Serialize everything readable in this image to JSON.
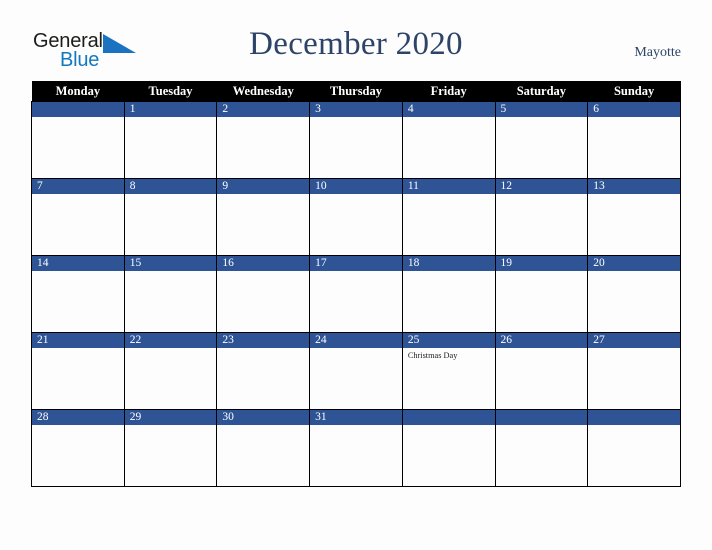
{
  "brand": {
    "name_part1": "General",
    "name_part2": "Blue",
    "flag_icon": "blue-triangle-flag-icon"
  },
  "header": {
    "title": "December 2020",
    "region": "Mayotte"
  },
  "colors": {
    "accent_blue": "#2f5496",
    "header_black": "#000000",
    "title_navy": "#2d4468",
    "logo_blue": "#1279be",
    "page_background": "#fdfdfd"
  },
  "calendar": {
    "month": "December",
    "year": "2020",
    "weekday_headers": [
      "Monday",
      "Tuesday",
      "Wednesday",
      "Thursday",
      "Friday",
      "Saturday",
      "Sunday"
    ],
    "weeks": [
      [
        {
          "day": "",
          "events": []
        },
        {
          "day": "1",
          "events": []
        },
        {
          "day": "2",
          "events": []
        },
        {
          "day": "3",
          "events": []
        },
        {
          "day": "4",
          "events": []
        },
        {
          "day": "5",
          "events": []
        },
        {
          "day": "6",
          "events": []
        }
      ],
      [
        {
          "day": "7",
          "events": []
        },
        {
          "day": "8",
          "events": []
        },
        {
          "day": "9",
          "events": []
        },
        {
          "day": "10",
          "events": []
        },
        {
          "day": "11",
          "events": []
        },
        {
          "day": "12",
          "events": []
        },
        {
          "day": "13",
          "events": []
        }
      ],
      [
        {
          "day": "14",
          "events": []
        },
        {
          "day": "15",
          "events": []
        },
        {
          "day": "16",
          "events": []
        },
        {
          "day": "17",
          "events": []
        },
        {
          "day": "18",
          "events": []
        },
        {
          "day": "19",
          "events": []
        },
        {
          "day": "20",
          "events": []
        }
      ],
      [
        {
          "day": "21",
          "events": []
        },
        {
          "day": "22",
          "events": []
        },
        {
          "day": "23",
          "events": []
        },
        {
          "day": "24",
          "events": []
        },
        {
          "day": "25",
          "events": [
            "Christmas Day"
          ]
        },
        {
          "day": "26",
          "events": []
        },
        {
          "day": "27",
          "events": []
        }
      ],
      [
        {
          "day": "28",
          "events": []
        },
        {
          "day": "29",
          "events": []
        },
        {
          "day": "30",
          "events": []
        },
        {
          "day": "31",
          "events": []
        },
        {
          "day": "",
          "events": []
        },
        {
          "day": "",
          "events": []
        },
        {
          "day": "",
          "events": []
        }
      ]
    ]
  }
}
